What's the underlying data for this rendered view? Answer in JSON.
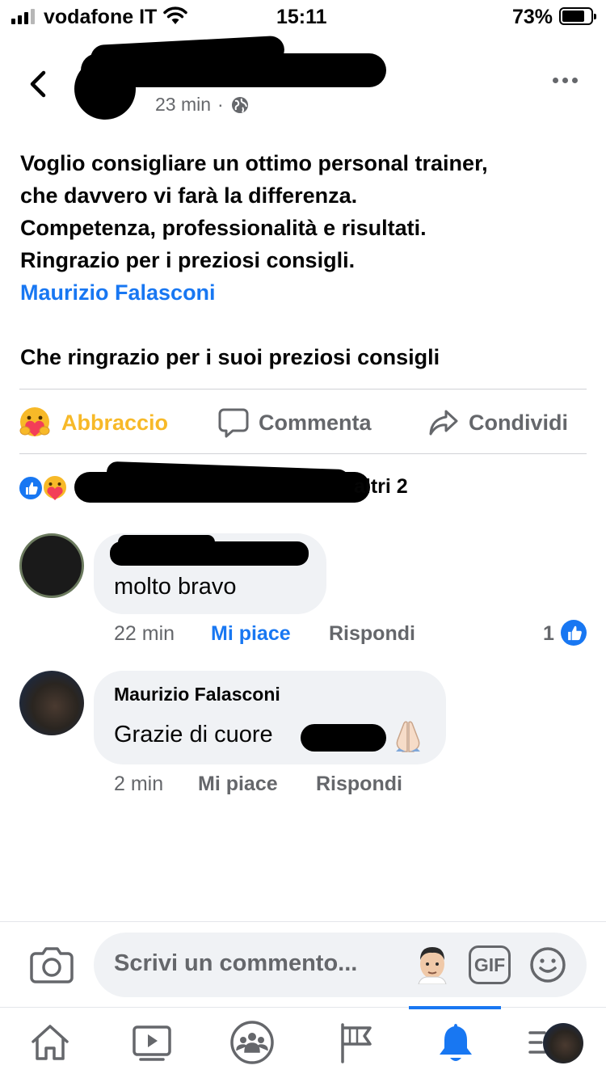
{
  "status_bar": {
    "carrier": "vodafone IT",
    "time": "15:11",
    "battery": "73%",
    "battery_level": 0.73
  },
  "post": {
    "time": "23 min",
    "separator": "·",
    "audience_icon": "globe-icon",
    "body_lines": [
      "Voglio consigliare un ottimo personal trainer,",
      "che davvero vi farà la differenza.",
      "Competenza, professionalità e risultati.",
      "Ringrazio per i preziosi consigli."
    ],
    "mention": "Maurizio Falasconi",
    "footer_line": "Che ringrazio per i suoi preziosi consigli"
  },
  "actions": {
    "react": "Abbraccio",
    "comment": "Commenta",
    "share": "Condividi"
  },
  "reactions": {
    "others_text": "altri 2",
    "icons": [
      "like-icon",
      "care-icon"
    ]
  },
  "comments": [
    {
      "text": "molto bravo",
      "time": "22 min",
      "like": "Mi piace",
      "reply": "Rispondi",
      "reaction_count": "1",
      "liked": true
    },
    {
      "author": "Maurizio Falasconi",
      "text": "Grazie di cuore",
      "time": "2 min",
      "like": "Mi piace",
      "reply": "Rispondi"
    }
  ],
  "composer": {
    "placeholder": "Scrivi un commento...",
    "gif_label": "GIF"
  },
  "colors": {
    "brand_blue": "#1877f2",
    "hug_yellow": "#f7b928",
    "secondary_text": "#65676b",
    "bubble_bg": "#f0f2f5"
  }
}
